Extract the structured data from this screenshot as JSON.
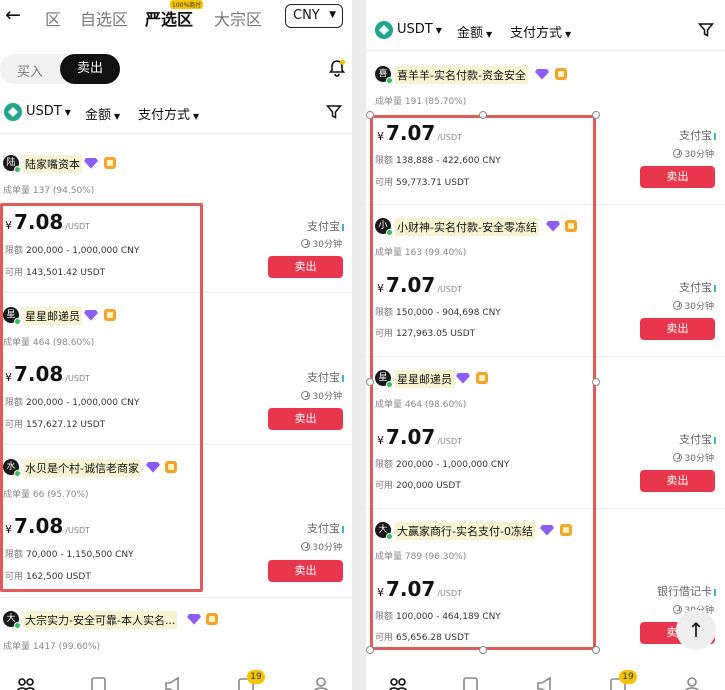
{
  "left": {
    "nav": {
      "back": "←",
      "tabs": [
        "区",
        "自选区",
        "严选区",
        "大宗区"
      ],
      "active_badge": "100%商付",
      "currency": "CNY"
    },
    "toggle": {
      "buy": "买入",
      "sell": "卖出"
    },
    "filter": {
      "coin": "USDT",
      "amount": "金额",
      "payment": "支付方式"
    },
    "merchants": [
      {
        "avatar": "陆",
        "name": "陆家嘴资本",
        "orders": "成单量 137 (94.50%)",
        "price": "7.08",
        "unit": "/USDT",
        "limit_label": "限额",
        "limit": "200,000 - 1,000,000 CNY",
        "avail_label": "可用",
        "avail": "143,501.42 USDT",
        "pay": "支付宝",
        "time": "30分钟",
        "action": "卖出"
      },
      {
        "avatar": "星",
        "name": "星星邮递员",
        "orders": "成单量 464 (98.60%)",
        "price": "7.08",
        "unit": "/USDT",
        "limit_label": "限额",
        "limit": "200,000 - 1,000,000 CNY",
        "avail_label": "可用",
        "avail": "157,627.12 USDT",
        "pay": "支付宝",
        "time": "30分钟",
        "action": "卖出"
      },
      {
        "avatar": "水",
        "name": "水贝是个村-诚信老商家",
        "orders": "成单量 66 (95.70%)",
        "price": "7.08",
        "unit": "/USDT",
        "limit_label": "限额",
        "limit": "70,000 - 1,150,500 CNY",
        "avail_label": "可用",
        "avail": "162,500 USDT",
        "pay": "支付宝",
        "time": "30分钟",
        "action": "卖出"
      },
      {
        "avatar": "大",
        "name": "大宗实力-安全可靠-本人实名...",
        "orders": "成单量 1417 (99.60%)"
      }
    ],
    "badge_count": "19"
  },
  "right": {
    "filter": {
      "coin": "USDT",
      "amount": "金额",
      "payment": "支付方式"
    },
    "merchants": [
      {
        "avatar": "喜",
        "name": "喜羊羊-实名付款-资金安全",
        "orders": "成单量 191 (85.70%)",
        "price": "7.07",
        "unit": "/USDT",
        "limit_label": "限额",
        "limit": "138,888 - 422,600 CNY",
        "avail_label": "可用",
        "avail": "59,773.71 USDT",
        "pay": "支付宝",
        "time": "30分钟",
        "action": "卖出"
      },
      {
        "avatar": "小",
        "name": "小财神-实名付款-安全零冻结",
        "orders": "成单量 163 (99.40%)",
        "price": "7.07",
        "unit": "/USDT",
        "limit_label": "限额",
        "limit": "150,000 - 904,698 CNY",
        "avail_label": "可用",
        "avail": "127,963.05 USDT",
        "pay": "支付宝",
        "time": "30分钟",
        "action": "卖出"
      },
      {
        "avatar": "星",
        "name": "星星邮递员",
        "orders": "成单量 464 (98.60%)",
        "price": "7.07",
        "unit": "/USDT",
        "limit_label": "限额",
        "limit": "200,000 - 1,000,000 CNY",
        "avail_label": "可用",
        "avail": "200,000 USDT",
        "pay": "支付宝",
        "time": "30分钟",
        "action": "卖出"
      },
      {
        "avatar": "大",
        "name": "大赢家商行-实名支付-0冻结",
        "orders": "成单量 789 (96.30%)",
        "price": "7.07",
        "unit": "/USDT",
        "limit_label": "限额",
        "limit": "100,000 - 464,189 CNY",
        "avail_label": "可用",
        "avail": "65,656.28 USDT",
        "pay": "银行借记卡",
        "time": "30分钟",
        "action": "卖出"
      }
    ],
    "badge_count": "19",
    "scroll_top": "↑"
  },
  "yen": "¥",
  "colors": {
    "accent_red": "#e8374d",
    "tether_green": "#22a68f",
    "highlight_box": "#e35a5a"
  }
}
